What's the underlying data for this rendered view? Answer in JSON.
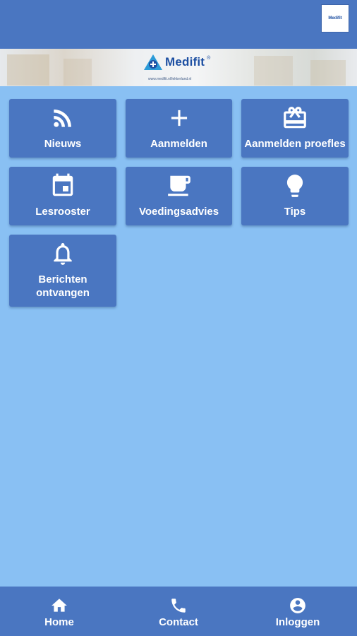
{
  "header": {
    "logo_text": "Medifit"
  },
  "banner": {
    "logo_text": "Medifit",
    "logo_mark": "®",
    "caption": "www.medifit.nl/lekkerland.nl"
  },
  "tiles": [
    {
      "label": "Nieuws",
      "icon": "rss-icon"
    },
    {
      "label": "Aanmelden",
      "icon": "plus-icon"
    },
    {
      "label": "Aanmelden proefles",
      "icon": "gift-icon"
    },
    {
      "label": "Lesrooster",
      "icon": "calendar-icon"
    },
    {
      "label": "Voedingsadvies",
      "icon": "coffee-icon"
    },
    {
      "label": "Tips",
      "icon": "lightbulb-icon"
    },
    {
      "label": "Berichten ontvangen",
      "icon": "bell-icon"
    }
  ],
  "bottom_nav": [
    {
      "label": "Home",
      "icon": "home-icon"
    },
    {
      "label": "Contact",
      "icon": "phone-icon"
    },
    {
      "label": "Inloggen",
      "icon": "account-icon"
    }
  ],
  "colors": {
    "primary": "#4a76c1",
    "background": "#89c0f3",
    "brand": "#1d4fa2"
  }
}
